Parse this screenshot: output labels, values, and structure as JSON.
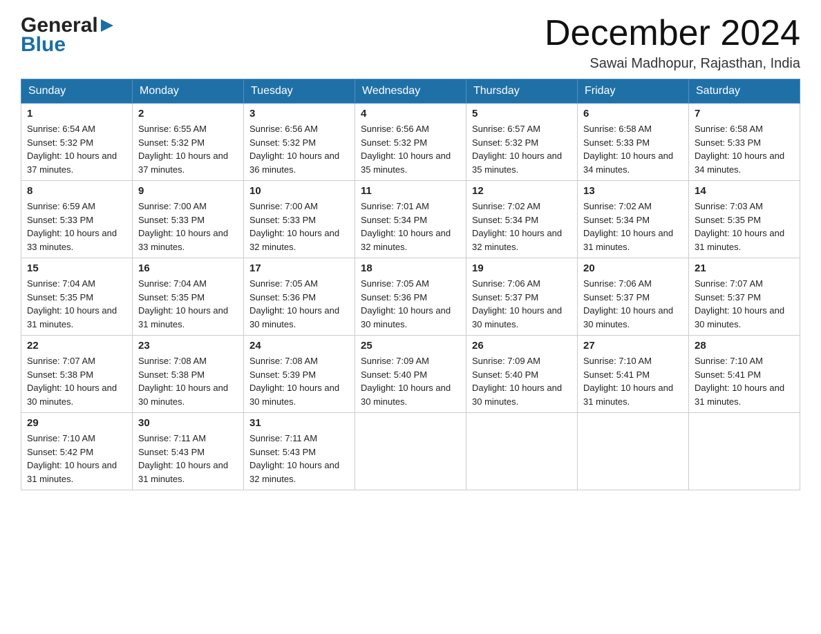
{
  "header": {
    "logo_general": "General",
    "logo_blue": "Blue",
    "month_title": "December 2024",
    "location": "Sawai Madhopur, Rajasthan, India"
  },
  "weekdays": [
    "Sunday",
    "Monday",
    "Tuesday",
    "Wednesday",
    "Thursday",
    "Friday",
    "Saturday"
  ],
  "weeks": [
    [
      {
        "day": "1",
        "sunrise": "6:54 AM",
        "sunset": "5:32 PM",
        "daylight": "10 hours and 37 minutes."
      },
      {
        "day": "2",
        "sunrise": "6:55 AM",
        "sunset": "5:32 PM",
        "daylight": "10 hours and 37 minutes."
      },
      {
        "day": "3",
        "sunrise": "6:56 AM",
        "sunset": "5:32 PM",
        "daylight": "10 hours and 36 minutes."
      },
      {
        "day": "4",
        "sunrise": "6:56 AM",
        "sunset": "5:32 PM",
        "daylight": "10 hours and 35 minutes."
      },
      {
        "day": "5",
        "sunrise": "6:57 AM",
        "sunset": "5:32 PM",
        "daylight": "10 hours and 35 minutes."
      },
      {
        "day": "6",
        "sunrise": "6:58 AM",
        "sunset": "5:33 PM",
        "daylight": "10 hours and 34 minutes."
      },
      {
        "day": "7",
        "sunrise": "6:58 AM",
        "sunset": "5:33 PM",
        "daylight": "10 hours and 34 minutes."
      }
    ],
    [
      {
        "day": "8",
        "sunrise": "6:59 AM",
        "sunset": "5:33 PM",
        "daylight": "10 hours and 33 minutes."
      },
      {
        "day": "9",
        "sunrise": "7:00 AM",
        "sunset": "5:33 PM",
        "daylight": "10 hours and 33 minutes."
      },
      {
        "day": "10",
        "sunrise": "7:00 AM",
        "sunset": "5:33 PM",
        "daylight": "10 hours and 32 minutes."
      },
      {
        "day": "11",
        "sunrise": "7:01 AM",
        "sunset": "5:34 PM",
        "daylight": "10 hours and 32 minutes."
      },
      {
        "day": "12",
        "sunrise": "7:02 AM",
        "sunset": "5:34 PM",
        "daylight": "10 hours and 32 minutes."
      },
      {
        "day": "13",
        "sunrise": "7:02 AM",
        "sunset": "5:34 PM",
        "daylight": "10 hours and 31 minutes."
      },
      {
        "day": "14",
        "sunrise": "7:03 AM",
        "sunset": "5:35 PM",
        "daylight": "10 hours and 31 minutes."
      }
    ],
    [
      {
        "day": "15",
        "sunrise": "7:04 AM",
        "sunset": "5:35 PM",
        "daylight": "10 hours and 31 minutes."
      },
      {
        "day": "16",
        "sunrise": "7:04 AM",
        "sunset": "5:35 PM",
        "daylight": "10 hours and 31 minutes."
      },
      {
        "day": "17",
        "sunrise": "7:05 AM",
        "sunset": "5:36 PM",
        "daylight": "10 hours and 30 minutes."
      },
      {
        "day": "18",
        "sunrise": "7:05 AM",
        "sunset": "5:36 PM",
        "daylight": "10 hours and 30 minutes."
      },
      {
        "day": "19",
        "sunrise": "7:06 AM",
        "sunset": "5:37 PM",
        "daylight": "10 hours and 30 minutes."
      },
      {
        "day": "20",
        "sunrise": "7:06 AM",
        "sunset": "5:37 PM",
        "daylight": "10 hours and 30 minutes."
      },
      {
        "day": "21",
        "sunrise": "7:07 AM",
        "sunset": "5:37 PM",
        "daylight": "10 hours and 30 minutes."
      }
    ],
    [
      {
        "day": "22",
        "sunrise": "7:07 AM",
        "sunset": "5:38 PM",
        "daylight": "10 hours and 30 minutes."
      },
      {
        "day": "23",
        "sunrise": "7:08 AM",
        "sunset": "5:38 PM",
        "daylight": "10 hours and 30 minutes."
      },
      {
        "day": "24",
        "sunrise": "7:08 AM",
        "sunset": "5:39 PM",
        "daylight": "10 hours and 30 minutes."
      },
      {
        "day": "25",
        "sunrise": "7:09 AM",
        "sunset": "5:40 PM",
        "daylight": "10 hours and 30 minutes."
      },
      {
        "day": "26",
        "sunrise": "7:09 AM",
        "sunset": "5:40 PM",
        "daylight": "10 hours and 30 minutes."
      },
      {
        "day": "27",
        "sunrise": "7:10 AM",
        "sunset": "5:41 PM",
        "daylight": "10 hours and 31 minutes."
      },
      {
        "day": "28",
        "sunrise": "7:10 AM",
        "sunset": "5:41 PM",
        "daylight": "10 hours and 31 minutes."
      }
    ],
    [
      {
        "day": "29",
        "sunrise": "7:10 AM",
        "sunset": "5:42 PM",
        "daylight": "10 hours and 31 minutes."
      },
      {
        "day": "30",
        "sunrise": "7:11 AM",
        "sunset": "5:43 PM",
        "daylight": "10 hours and 31 minutes."
      },
      {
        "day": "31",
        "sunrise": "7:11 AM",
        "sunset": "5:43 PM",
        "daylight": "10 hours and 32 minutes."
      },
      null,
      null,
      null,
      null
    ]
  ]
}
